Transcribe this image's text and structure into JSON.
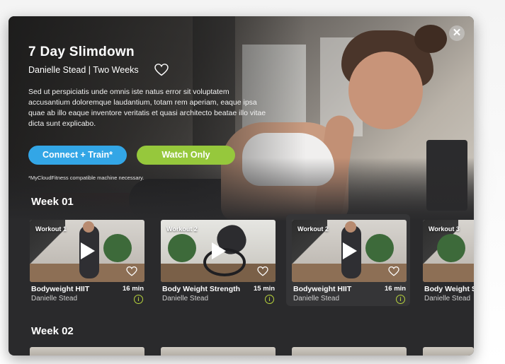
{
  "program": {
    "title": "7 Day Slimdown",
    "subtitle": "Danielle Stead | Two Weeks",
    "description": "Sed ut perspiciatis unde omnis iste natus error sit voluptatem accusantium doloremque laudantium, totam rem aperiam, eaque ipsa quae ab illo eaque inventore veritatis et quasi architecto beatae illo vitae dicta sunt explicabo.",
    "connect_label": "Connect + Train*",
    "watch_label": "Watch Only",
    "note": "*MyCloudFitness compatible machine necessary.",
    "close_glyph": "✕"
  },
  "colors": {
    "connect": "#33a6e6",
    "watch": "#96c83c",
    "info": "#b8d43c",
    "modal_bg": "#2a2a2c"
  },
  "weeks": [
    {
      "title": "Week 01",
      "workouts": [
        {
          "label": "Workout 1",
          "name": "Bodyweight HIIT",
          "duration": "16 min",
          "coach": "Danielle Stead"
        },
        {
          "label": "Workout 2",
          "name": "Body Weight Strength",
          "duration": "15 min",
          "coach": "Danielle Stead"
        },
        {
          "label": "Workout 2",
          "name": "Bodyweight HIIT",
          "duration": "16 min",
          "coach": "Danielle Stead"
        },
        {
          "label": "Workout 3",
          "name": "Body Weight S",
          "duration": "",
          "coach": "Danielle Stead"
        }
      ]
    },
    {
      "title": "Week 02",
      "workouts": []
    }
  ],
  "icons": {
    "info_glyph": "i"
  }
}
